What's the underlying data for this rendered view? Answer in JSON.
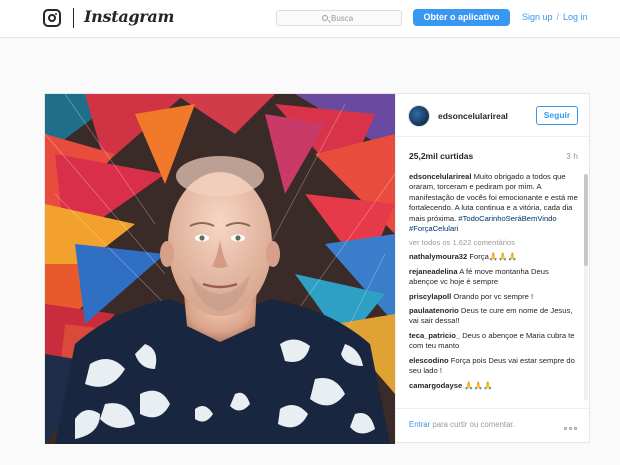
{
  "header": {
    "brand": "Instagram",
    "search_placeholder": "Busca",
    "get_app_label": "Obter o aplicativo",
    "signup_label": "Sign up",
    "separator": "/",
    "login_label": "Log in"
  },
  "post": {
    "username": "edsoncelularireal",
    "follow_label": "Seguir",
    "likes": "25,2mil curtidas",
    "time_ago": "3 h",
    "caption": {
      "user": "edsoncelularireal",
      "text": "Muito obrigado a todos que oraram, torceram e pediram por mim. A manifestação de vocês foi emocionante e está me fortalecendo. A luta continua e a vitória, cada dia mais próxima.",
      "hashtags": "#TodoCarinhoSeráBemVindo #ForçaCelulari"
    },
    "view_all": "ver todos os 1.622 comentários",
    "comments": [
      {
        "user": "nathalymoura32",
        "text": "Força🙏🙏🙏"
      },
      {
        "user": "rejaneadelina",
        "text": "A fé move montanha Deus abençoe vc hoje é sempre"
      },
      {
        "user": "priscylapoll",
        "text": "Orando por vc sempre !"
      },
      {
        "user": "paulaatenorio",
        "text": "Deus te cure em nome de Jesus, vai sair dessa!!"
      },
      {
        "user": "teca_patricio_",
        "text": "Deus o abençoe e Maria cubra te com teu manto"
      },
      {
        "user": "elescodino",
        "text": "Força pois Deus vai estar sempre do seu lado !"
      },
      {
        "user": "camargodayse",
        "text": "🙏🙏🙏"
      }
    ],
    "footer": {
      "enter_label": "Entrar",
      "footer_text": " para curtir ou comentar."
    }
  },
  "colors": {
    "accent": "#3897f0",
    "text": "#262626",
    "muted": "#999999",
    "background": "#fafafa"
  }
}
